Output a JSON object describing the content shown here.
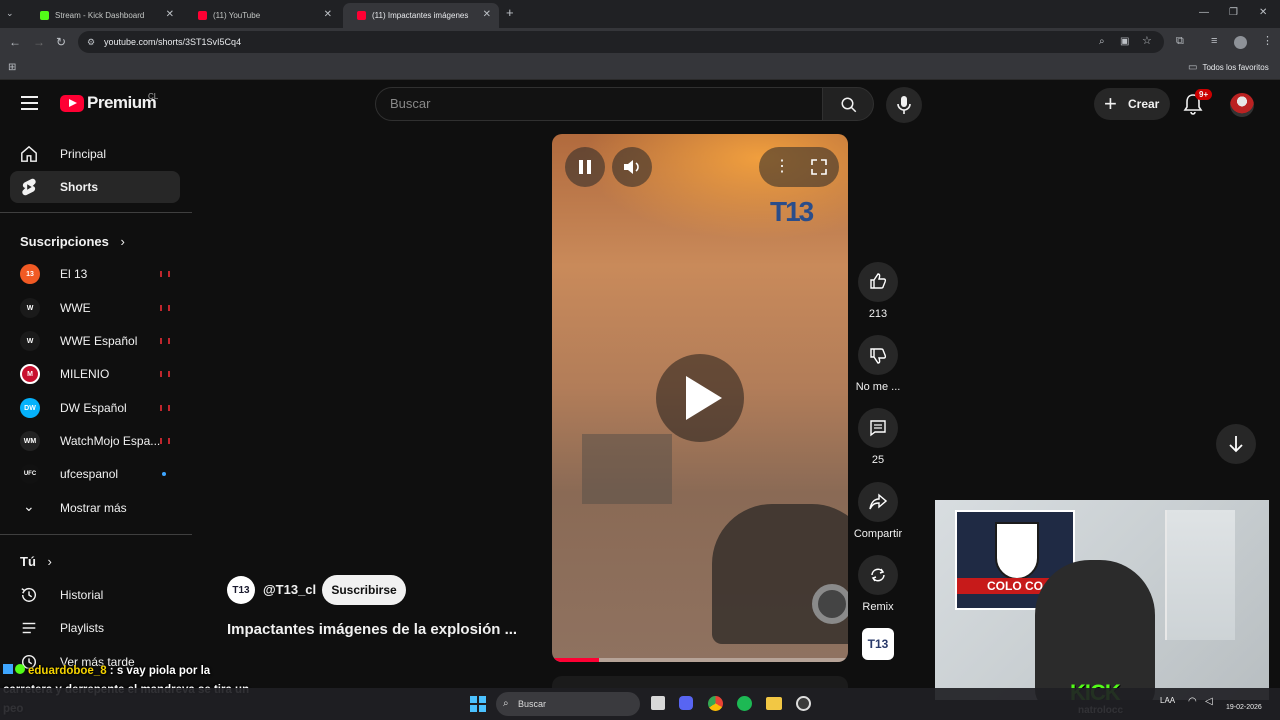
{
  "browser": {
    "tabs": [
      {
        "label": "Stream - Kick Dashboard",
        "color": "#53fc18"
      },
      {
        "label": "(11) YouTube",
        "color": "#ff0033"
      },
      {
        "label": "(11) Impactantes imágenes",
        "color": "#ff0033"
      }
    ],
    "url": "youtube.com/shorts/3ST1SvI5Cq4",
    "bookmarks_label": "Todos los favoritos"
  },
  "header": {
    "logo_text": "Premium",
    "region": "CL",
    "search_placeholder": "Buscar",
    "create_label": "Crear",
    "notifications_badge": "9+"
  },
  "sidebar": {
    "main": [
      {
        "label": "Principal",
        "icon": "home-icon"
      },
      {
        "label": "Shorts",
        "icon": "shorts-icon"
      }
    ],
    "subscriptions_title": "Suscripciones",
    "channels": [
      {
        "label": "El 13",
        "avatar": "13",
        "color": "#f15a24",
        "live": true
      },
      {
        "label": "WWE",
        "avatar": "W",
        "color": "#1a1a1a",
        "live": true
      },
      {
        "label": "WWE Español",
        "avatar": "W",
        "color": "#1a1a1a",
        "live": true
      },
      {
        "label": "MILENIO",
        "avatar": "M",
        "color": "#c8102e",
        "live": true
      },
      {
        "label": "DW Español",
        "avatar": "DW",
        "color": "#05b2fc",
        "live": true
      },
      {
        "label": "WatchMojo Espa...",
        "avatar": "WM",
        "color": "#222",
        "live": true
      },
      {
        "label": "ufcespanol",
        "avatar": "UFC",
        "color": "#111",
        "live": false
      }
    ],
    "show_more": "Mostrar más",
    "you_title": "Tú",
    "you_items": [
      {
        "label": "Historial",
        "icon": "history-icon"
      },
      {
        "label": "Playlists",
        "icon": "playlists-icon"
      },
      {
        "label": "Ver más tarde",
        "icon": "watch-later-icon"
      }
    ]
  },
  "short": {
    "channel_handle": "@T13_cl",
    "channel_avatar": "T13",
    "subscribe_label": "Suscribirse",
    "title": "Impactantes imágenes de la explosión ...",
    "watermark": "T13",
    "progress": 0.16
  },
  "actions": {
    "likes": "213",
    "dislike_label": "No me ...",
    "comments": "25",
    "share_label": "Compartir",
    "remix_label": "Remix"
  },
  "stream": {
    "chat_user": "eduardoboe_8",
    "chat_message": "s vay piola por la carretera y derrepente el mandreva se tira un peo",
    "kick_logo": "KICK",
    "kick_user": "natrolocc",
    "banner_text": "COLO CO"
  },
  "taskbar": {
    "search_label": "Buscar",
    "lang": "LAA",
    "date": "19-02-2026"
  }
}
